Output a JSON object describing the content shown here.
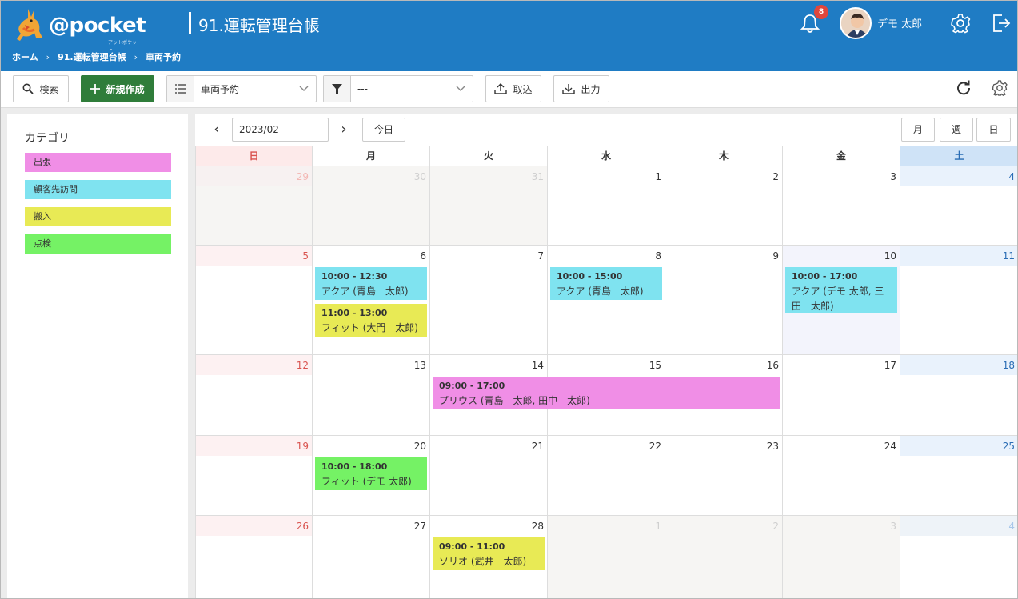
{
  "header": {
    "logo_text": "@pocket",
    "logo_sub": "アットポケット",
    "title": "91.運転管理台帳",
    "notification_count": "8",
    "user_name": "デモ 太郎"
  },
  "breadcrumb": [
    "ホーム",
    "91.運転管理台帳",
    "車両予約"
  ],
  "toolbar": {
    "search_label": "検索",
    "new_label": "新規作成",
    "view_select_value": "車両予約",
    "filter_select_value": "---",
    "import_label": "取込",
    "export_label": "出力"
  },
  "sidebar": {
    "title": "カテゴリ",
    "categories": [
      {
        "label": "出張",
        "color": "#f08ee6"
      },
      {
        "label": "顧客先訪問",
        "color": "#7fe3f0"
      },
      {
        "label": "搬入",
        "color": "#e8ea55"
      },
      {
        "label": "点検",
        "color": "#75f265"
      }
    ]
  },
  "calendar": {
    "month": "2023/02",
    "today_label": "今日",
    "view_buttons": [
      "月",
      "週",
      "日"
    ],
    "weekdays": [
      "日",
      "月",
      "火",
      "水",
      "木",
      "金",
      "土"
    ],
    "weeks": [
      [
        "29",
        "30",
        "31",
        "1",
        "2",
        "3",
        "4"
      ],
      [
        "5",
        "6",
        "7",
        "8",
        "9",
        "10",
        "11"
      ],
      [
        "12",
        "13",
        "14",
        "15",
        "16",
        "17",
        "18"
      ],
      [
        "19",
        "20",
        "21",
        "22",
        "23",
        "24",
        "25"
      ],
      [
        "26",
        "27",
        "28",
        "1",
        "2",
        "3",
        "4"
      ]
    ],
    "events": [
      {
        "week": 1,
        "day": 1,
        "span": 1,
        "slot": 0,
        "time": "10:00 - 12:30",
        "title": "アクア (青島　太郎)",
        "category": "顧客先訪問"
      },
      {
        "week": 1,
        "day": 1,
        "span": 1,
        "slot": 1,
        "time": "11:00 - 13:00",
        "title": "フィット (大門　太郎)",
        "category": "搬入"
      },
      {
        "week": 1,
        "day": 3,
        "span": 1,
        "slot": 0,
        "time": "10:00 - 15:00",
        "title": "アクア (青島　太郎)",
        "category": "顧客先訪問"
      },
      {
        "week": 1,
        "day": 5,
        "span": 1,
        "slot": 0,
        "time": "10:00 - 17:00",
        "title": "アクア (デモ 太郎, 三田　太郎)",
        "category": "顧客先訪問"
      },
      {
        "week": 2,
        "day": 2,
        "span": 3,
        "slot": 0,
        "time": "09:00 - 17:00",
        "title": "プリウス (青島　太郎, 田中　太郎)",
        "category": "出張"
      },
      {
        "week": 3,
        "day": 1,
        "span": 1,
        "slot": 0,
        "time": "10:00 - 18:00",
        "title": "フィット (デモ 太郎)",
        "category": "点検"
      },
      {
        "week": 4,
        "day": 2,
        "span": 1,
        "slot": 0,
        "time": "09:00 - 11:00",
        "title": "ソリオ (武井　太郎)",
        "category": "搬入"
      }
    ]
  }
}
